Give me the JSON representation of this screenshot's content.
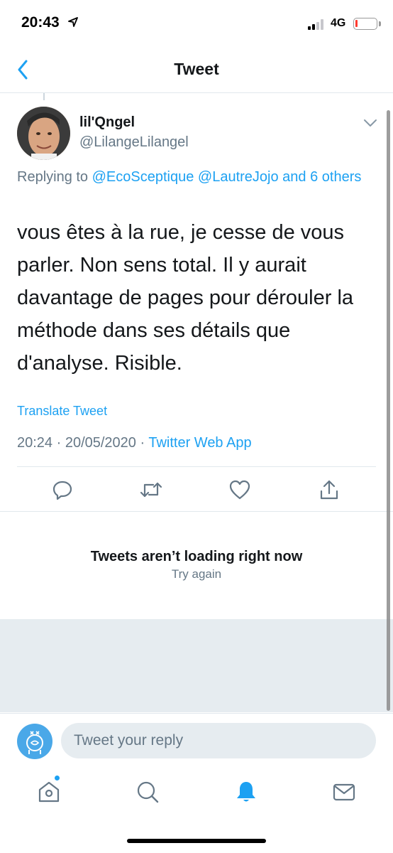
{
  "status_bar": {
    "time": "20:43",
    "network": "4G"
  },
  "nav": {
    "title": "Tweet"
  },
  "tweet": {
    "author_name": "lil'Qngel",
    "author_handle": "@LilangeLilangel",
    "replying_prefix": "Replying to ",
    "replying_to": "@EcoSceptique @LautreJojo and 6 others",
    "text": "vous êtes à la rue, je cesse de vous parler. Non sens total. Il y aurait davantage de pages pour dérouler la méthode dans ses détails que d'analyse. Risible.",
    "translate_label": "Translate Tweet",
    "timestamp": "20:24 · 20/05/2020 · ",
    "source_app": "Twitter Web App"
  },
  "actions": [
    "reply-icon",
    "retweet-icon",
    "like-icon",
    "share-icon"
  ],
  "error": {
    "title": "Tweets aren’t loading right now",
    "retry": "Try again"
  },
  "reply_bar": {
    "placeholder": "Tweet your reply"
  },
  "tab_bar": {
    "items": [
      "home-icon",
      "search-icon",
      "notifications-icon",
      "messages-icon"
    ],
    "active": "notifications-icon"
  },
  "colors": {
    "accent": "#1da1f2",
    "secondary_text": "#657786",
    "divider": "#e1e8ed",
    "placeholder_bg": "#e6ecf0"
  }
}
